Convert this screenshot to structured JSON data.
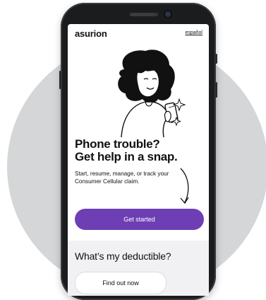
{
  "app": {
    "logo": "asurion",
    "language_link": "español"
  },
  "hero": {
    "illustration": "woman-holding-phone-illustration",
    "headline_line1": "Phone trouble?",
    "headline_line2": "Get help in a snap.",
    "subtext": "Start, resume, manage, or track your Consumer Cellular claim.",
    "cta_label": "Get started"
  },
  "deductible": {
    "title": "What’s my deductible?",
    "button_label": "Find out now"
  },
  "colors": {
    "accent": "#6e3fb4",
    "background_circle": "#d4d6d7",
    "phone_body": "#1b1c1e",
    "section_bg": "#f1f1f3"
  }
}
